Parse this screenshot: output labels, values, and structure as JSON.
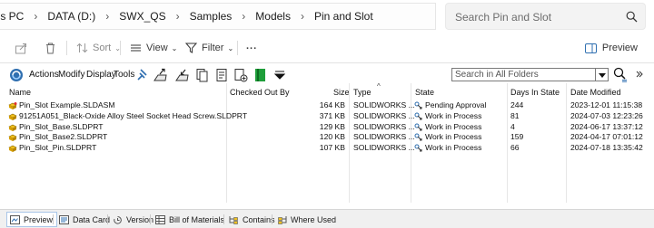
{
  "breadcrumb": [
    "his PC",
    "DATA (D:)",
    "SWX_QS",
    "Samples",
    "Models",
    "Pin and Slot"
  ],
  "search": {
    "placeholder": "Search Pin and Slot"
  },
  "commandbar": {
    "sort": "Sort",
    "view": "View",
    "filter": "Filter",
    "more": "...",
    "preview": "Preview"
  },
  "pdm_toolbar": {
    "actions": "Actions",
    "modify": "Modify",
    "display": "Display",
    "tools": "Tools",
    "search_placeholder": "Search in All Folders"
  },
  "columns": {
    "name": "Name",
    "checked_out_by": "Checked Out By",
    "size": "Size",
    "type": "Type",
    "state": "State",
    "days_in_state": "Days In State",
    "date_modified": "Date Modified"
  },
  "files": [
    {
      "name": "Pin_Slot Example.SLDASM",
      "checked_out_by": "",
      "size": "164 KB",
      "type": "SOLIDWORKS ...",
      "state": "Pending Approval",
      "days": "244",
      "modified": "2023-12-01 11:15:38",
      "kind": "assembly"
    },
    {
      "name": "91251A051_Black-Oxide Alloy Steel Socket Head Screw.SLDPRT",
      "checked_out_by": "",
      "size": "371 KB",
      "type": "SOLIDWORKS ...",
      "state": "Work in Process",
      "days": "81",
      "modified": "2024-07-03 12:23:26",
      "kind": "part"
    },
    {
      "name": "Pin_Slot_Base.SLDPRT",
      "checked_out_by": "",
      "size": "129 KB",
      "type": "SOLIDWORKS ...",
      "state": "Work in Process",
      "days": "4",
      "modified": "2024-06-17 13:37:12",
      "kind": "part"
    },
    {
      "name": "Pin_Slot_Base2.SLDPRT",
      "checked_out_by": "",
      "size": "120 KB",
      "type": "SOLIDWORKS ...",
      "state": "Work in Process",
      "days": "159",
      "modified": "2024-04-17 07:01:12",
      "kind": "part"
    },
    {
      "name": "Pin_Slot_Pin.SLDPRT",
      "checked_out_by": "",
      "size": "107 KB",
      "type": "SOLIDWORKS ...",
      "state": "Work in Process",
      "days": "66",
      "modified": "2024-07-18 13:35:42",
      "kind": "part"
    }
  ],
  "tabs": [
    {
      "label": "Preview",
      "icon": "preview-icon",
      "active": true
    },
    {
      "label": "Data Card",
      "icon": "data-card-icon",
      "active": false
    },
    {
      "label": "Version",
      "icon": "version-icon",
      "active": false
    },
    {
      "label": "Bill of Materials",
      "icon": "bom-icon",
      "active": false
    },
    {
      "label": "Contains",
      "icon": "contains-icon",
      "active": false
    },
    {
      "label": "Where Used",
      "icon": "where-used-icon",
      "active": false
    }
  ],
  "colors": {
    "accent": "#2f6fb0",
    "pdm_green": "#1e9e3a",
    "part_yellow": "#d8a000"
  }
}
